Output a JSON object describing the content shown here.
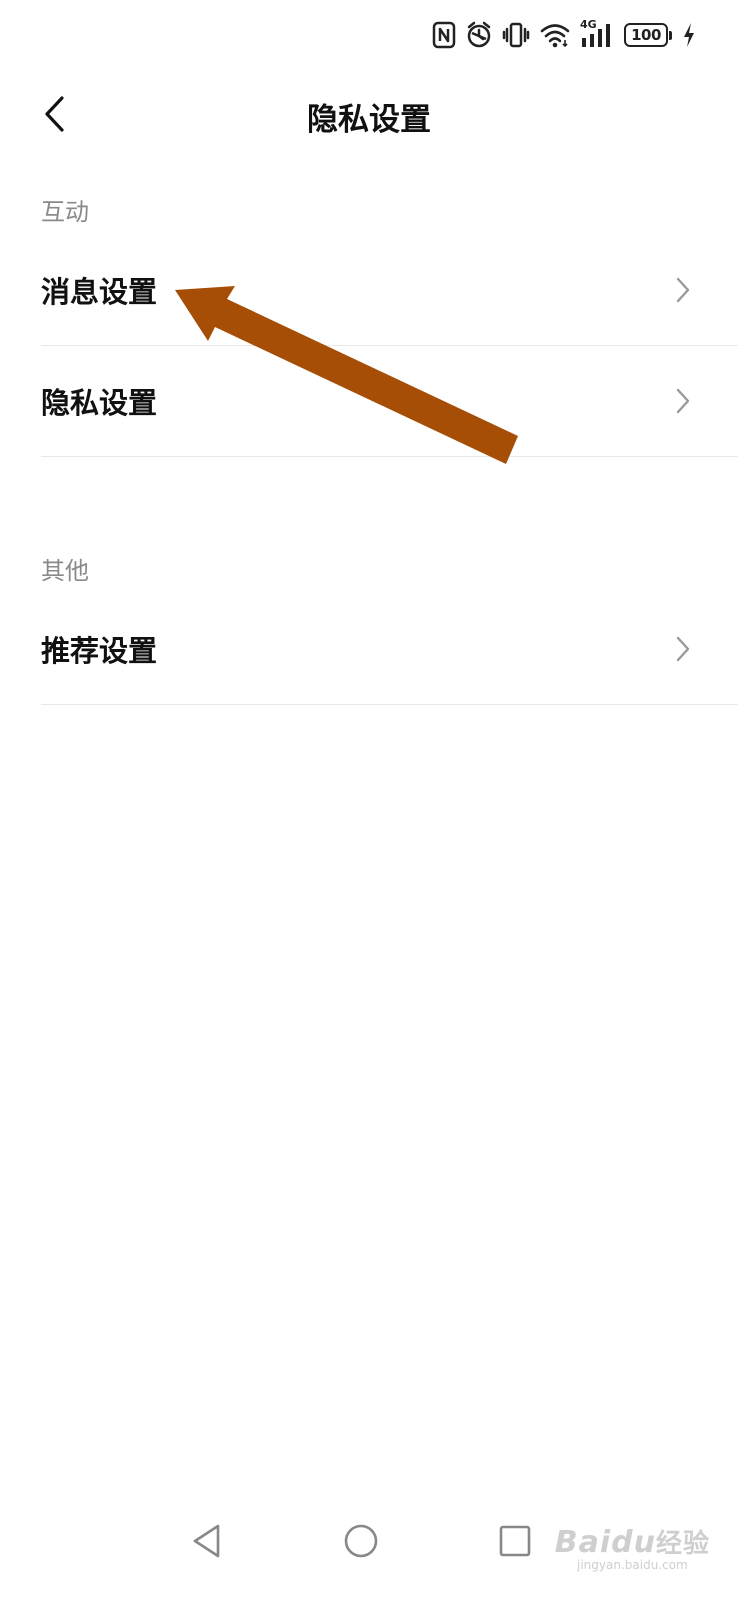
{
  "status_bar": {
    "network_label": "4G",
    "battery_level": "100",
    "icons": [
      "nfc-icon",
      "alarm-icon",
      "vibrate-icon",
      "wifi-icon",
      "signal-icon",
      "battery-icon",
      "charging-icon"
    ]
  },
  "header": {
    "title": "隐私设置",
    "back_icon": "chevron-left-icon"
  },
  "sections": [
    {
      "label": "互动",
      "items": [
        {
          "label": "消息设置"
        },
        {
          "label": "隐私设置"
        }
      ]
    },
    {
      "label": "其他",
      "items": [
        {
          "label": "推荐设置"
        }
      ]
    }
  ],
  "annotation": {
    "type": "arrow",
    "color": "#a64e06",
    "points_to": "消息设置"
  },
  "nav_bar": {
    "icons": [
      "back-triangle-icon",
      "home-circle-icon",
      "recents-square-icon"
    ]
  },
  "watermark": {
    "logo_text": "Baidu",
    "logo_cn": "经验",
    "url": "jingyan.baidu.com"
  }
}
